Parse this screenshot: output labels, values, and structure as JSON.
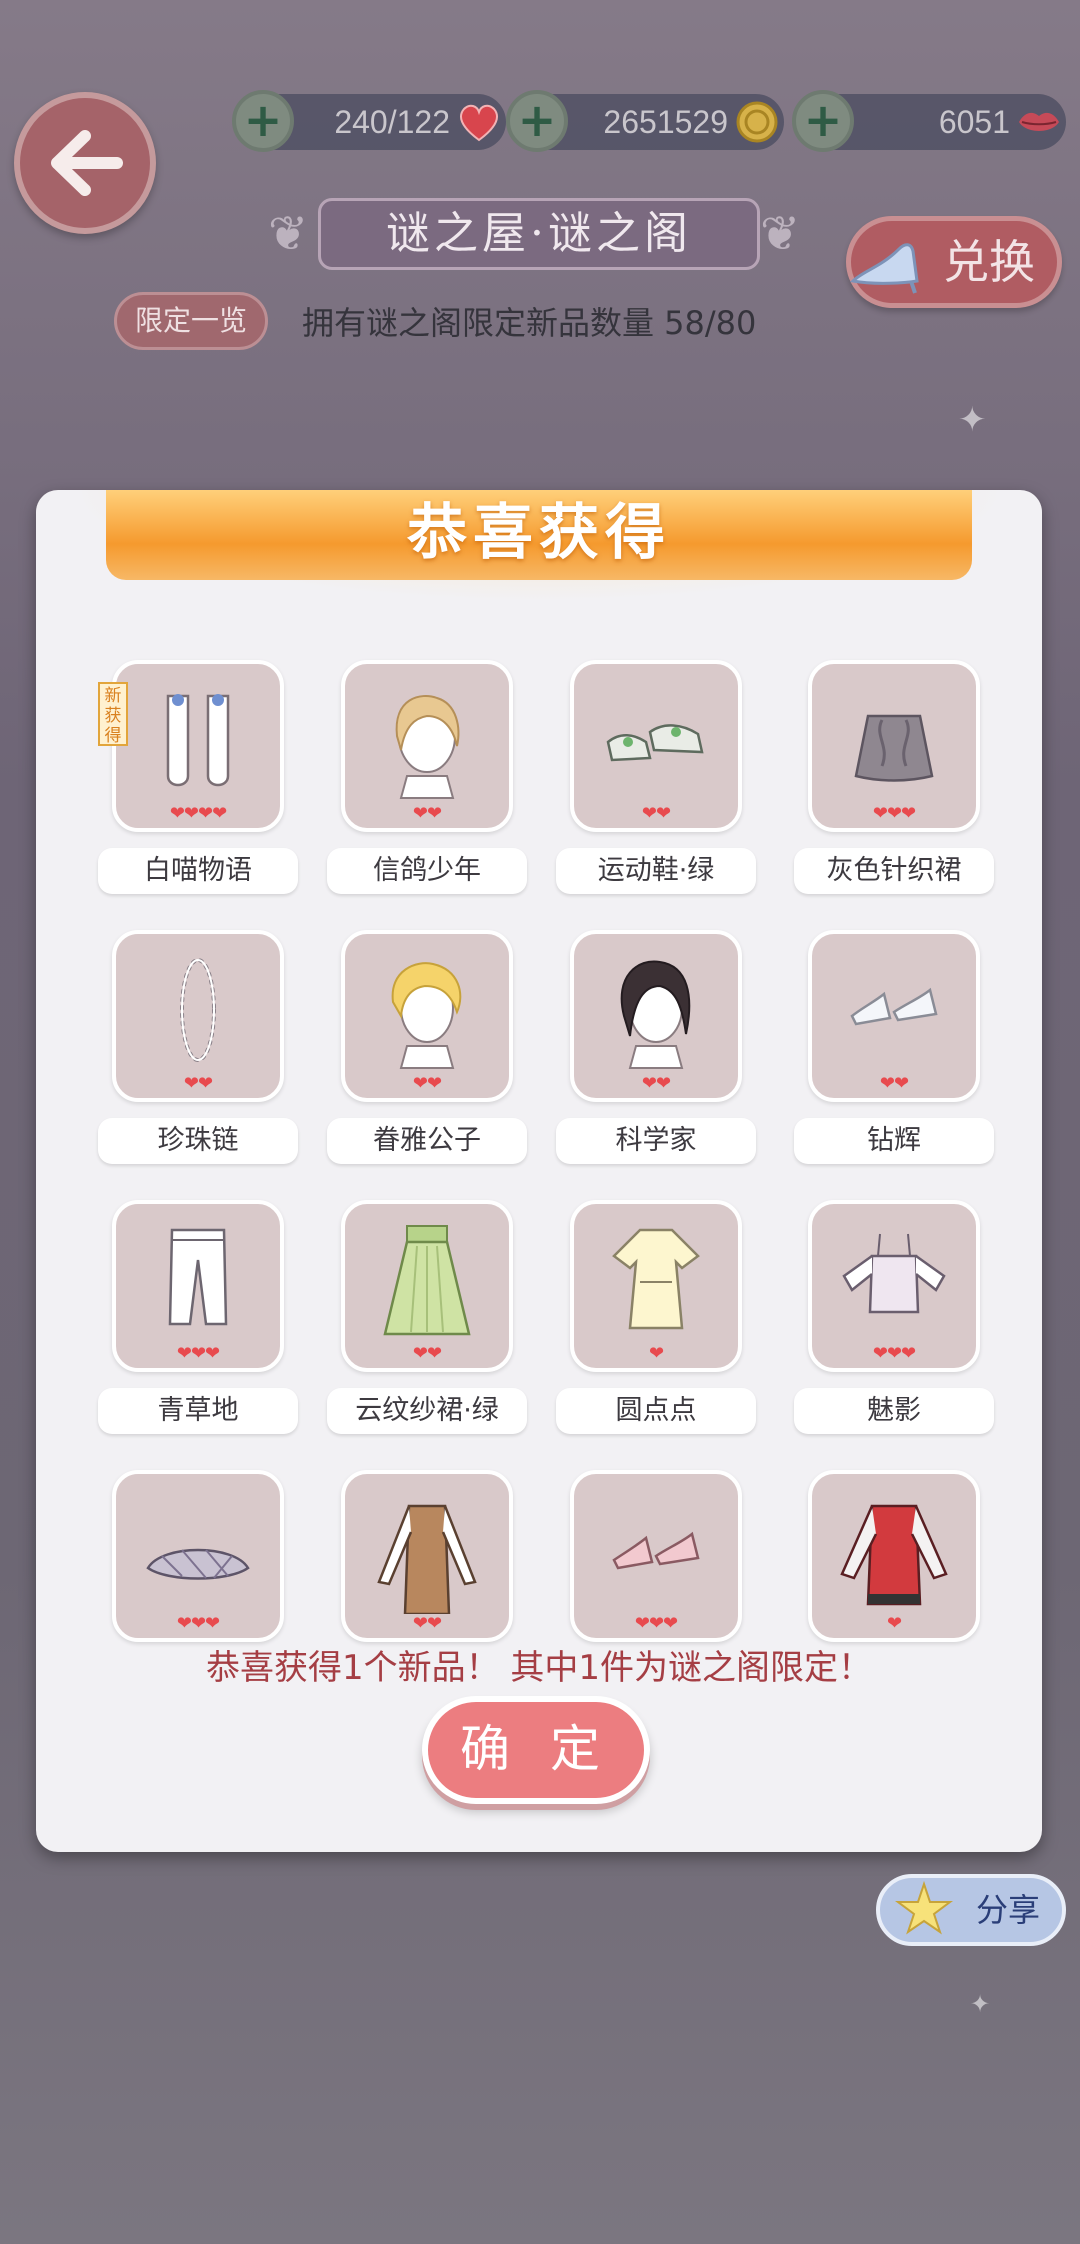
{
  "header": {
    "hearts_value": "240/122",
    "coins_value": "2651529",
    "diamonds_value": "6051",
    "title": "谜之屋·谜之阁",
    "exchange_label": "兑换",
    "limited_label": "限定一览",
    "owned_text": "拥有谜之阁限定新品数量 58/80"
  },
  "modal": {
    "banner": "恭喜获得",
    "new_tag": "新获得",
    "items": [
      {
        "name": "白喵物语",
        "hearts": "❤❤❤❤",
        "icon": "socks-icon"
      },
      {
        "name": "信鸽少年",
        "hearts": "❤❤",
        "icon": "blonde-hair-icon"
      },
      {
        "name": "运动鞋·绿",
        "hearts": "❤❤",
        "icon": "sneakers-icon"
      },
      {
        "name": "灰色针织裙",
        "hearts": "❤❤❤",
        "icon": "knit-skirt-icon"
      },
      {
        "name": "珍珠链",
        "hearts": "❤❤",
        "icon": "pearl-necklace-icon"
      },
      {
        "name": "眷雅公子",
        "hearts": "❤❤",
        "icon": "yellow-hair-icon"
      },
      {
        "name": "科学家",
        "hearts": "❤❤",
        "icon": "dark-hair-icon"
      },
      {
        "name": "钻辉",
        "hearts": "❤❤",
        "icon": "glass-heels-icon"
      },
      {
        "name": "青草地",
        "hearts": "❤❤❤",
        "icon": "white-pants-icon"
      },
      {
        "name": "云纹纱裙·绿",
        "hearts": "❤❤",
        "icon": "green-skirt-icon"
      },
      {
        "name": "圆点点",
        "hearts": "❤",
        "icon": "dot-dress-icon"
      },
      {
        "name": "魅影",
        "hearts": "❤❤❤",
        "icon": "camisole-icon"
      },
      {
        "name": "",
        "hearts": "❤❤❤",
        "icon": "plaid-shawl-icon"
      },
      {
        "name": "",
        "hearts": "❤❤",
        "icon": "brown-dress-icon"
      },
      {
        "name": "",
        "hearts": "❤❤❤",
        "icon": "pink-heels-icon"
      },
      {
        "name": "",
        "hearts": "❤",
        "icon": "red-jacket-icon"
      }
    ],
    "congrats_text": "恭喜获得1个新品！ 其中1件为谜之阁限定！",
    "confirm_label": "确 定"
  },
  "share_label": "分享",
  "colors": {
    "accent_red": "#ec7d80",
    "banner_orange": "#f59a2e",
    "heart_red": "#e84a4e",
    "card_bg": "#d9c9ca"
  }
}
